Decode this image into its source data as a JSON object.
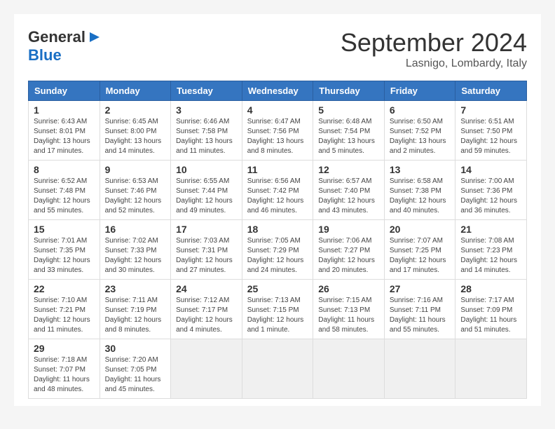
{
  "header": {
    "logo_general": "General",
    "logo_blue": "Blue",
    "month_title": "September 2024",
    "location": "Lasnigo, Lombardy, Italy"
  },
  "columns": [
    "Sunday",
    "Monday",
    "Tuesday",
    "Wednesday",
    "Thursday",
    "Friday",
    "Saturday"
  ],
  "weeks": [
    [
      {
        "day": "1",
        "info": "Sunrise: 6:43 AM\nSunset: 8:01 PM\nDaylight: 13 hours\nand 17 minutes."
      },
      {
        "day": "2",
        "info": "Sunrise: 6:45 AM\nSunset: 8:00 PM\nDaylight: 13 hours\nand 14 minutes."
      },
      {
        "day": "3",
        "info": "Sunrise: 6:46 AM\nSunset: 7:58 PM\nDaylight: 13 hours\nand 11 minutes."
      },
      {
        "day": "4",
        "info": "Sunrise: 6:47 AM\nSunset: 7:56 PM\nDaylight: 13 hours\nand 8 minutes."
      },
      {
        "day": "5",
        "info": "Sunrise: 6:48 AM\nSunset: 7:54 PM\nDaylight: 13 hours\nand 5 minutes."
      },
      {
        "day": "6",
        "info": "Sunrise: 6:50 AM\nSunset: 7:52 PM\nDaylight: 13 hours\nand 2 minutes."
      },
      {
        "day": "7",
        "info": "Sunrise: 6:51 AM\nSunset: 7:50 PM\nDaylight: 12 hours\nand 59 minutes."
      }
    ],
    [
      {
        "day": "8",
        "info": "Sunrise: 6:52 AM\nSunset: 7:48 PM\nDaylight: 12 hours\nand 55 minutes."
      },
      {
        "day": "9",
        "info": "Sunrise: 6:53 AM\nSunset: 7:46 PM\nDaylight: 12 hours\nand 52 minutes."
      },
      {
        "day": "10",
        "info": "Sunrise: 6:55 AM\nSunset: 7:44 PM\nDaylight: 12 hours\nand 49 minutes."
      },
      {
        "day": "11",
        "info": "Sunrise: 6:56 AM\nSunset: 7:42 PM\nDaylight: 12 hours\nand 46 minutes."
      },
      {
        "day": "12",
        "info": "Sunrise: 6:57 AM\nSunset: 7:40 PM\nDaylight: 12 hours\nand 43 minutes."
      },
      {
        "day": "13",
        "info": "Sunrise: 6:58 AM\nSunset: 7:38 PM\nDaylight: 12 hours\nand 40 minutes."
      },
      {
        "day": "14",
        "info": "Sunrise: 7:00 AM\nSunset: 7:36 PM\nDaylight: 12 hours\nand 36 minutes."
      }
    ],
    [
      {
        "day": "15",
        "info": "Sunrise: 7:01 AM\nSunset: 7:35 PM\nDaylight: 12 hours\nand 33 minutes."
      },
      {
        "day": "16",
        "info": "Sunrise: 7:02 AM\nSunset: 7:33 PM\nDaylight: 12 hours\nand 30 minutes."
      },
      {
        "day": "17",
        "info": "Sunrise: 7:03 AM\nSunset: 7:31 PM\nDaylight: 12 hours\nand 27 minutes."
      },
      {
        "day": "18",
        "info": "Sunrise: 7:05 AM\nSunset: 7:29 PM\nDaylight: 12 hours\nand 24 minutes."
      },
      {
        "day": "19",
        "info": "Sunrise: 7:06 AM\nSunset: 7:27 PM\nDaylight: 12 hours\nand 20 minutes."
      },
      {
        "day": "20",
        "info": "Sunrise: 7:07 AM\nSunset: 7:25 PM\nDaylight: 12 hours\nand 17 minutes."
      },
      {
        "day": "21",
        "info": "Sunrise: 7:08 AM\nSunset: 7:23 PM\nDaylight: 12 hours\nand 14 minutes."
      }
    ],
    [
      {
        "day": "22",
        "info": "Sunrise: 7:10 AM\nSunset: 7:21 PM\nDaylight: 12 hours\nand 11 minutes."
      },
      {
        "day": "23",
        "info": "Sunrise: 7:11 AM\nSunset: 7:19 PM\nDaylight: 12 hours\nand 8 minutes."
      },
      {
        "day": "24",
        "info": "Sunrise: 7:12 AM\nSunset: 7:17 PM\nDaylight: 12 hours\nand 4 minutes."
      },
      {
        "day": "25",
        "info": "Sunrise: 7:13 AM\nSunset: 7:15 PM\nDaylight: 12 hours\nand 1 minute."
      },
      {
        "day": "26",
        "info": "Sunrise: 7:15 AM\nSunset: 7:13 PM\nDaylight: 11 hours\nand 58 minutes."
      },
      {
        "day": "27",
        "info": "Sunrise: 7:16 AM\nSunset: 7:11 PM\nDaylight: 11 hours\nand 55 minutes."
      },
      {
        "day": "28",
        "info": "Sunrise: 7:17 AM\nSunset: 7:09 PM\nDaylight: 11 hours\nand 51 minutes."
      }
    ],
    [
      {
        "day": "29",
        "info": "Sunrise: 7:18 AM\nSunset: 7:07 PM\nDaylight: 11 hours\nand 48 minutes."
      },
      {
        "day": "30",
        "info": "Sunrise: 7:20 AM\nSunset: 7:05 PM\nDaylight: 11 hours\nand 45 minutes."
      },
      null,
      null,
      null,
      null,
      null
    ]
  ]
}
